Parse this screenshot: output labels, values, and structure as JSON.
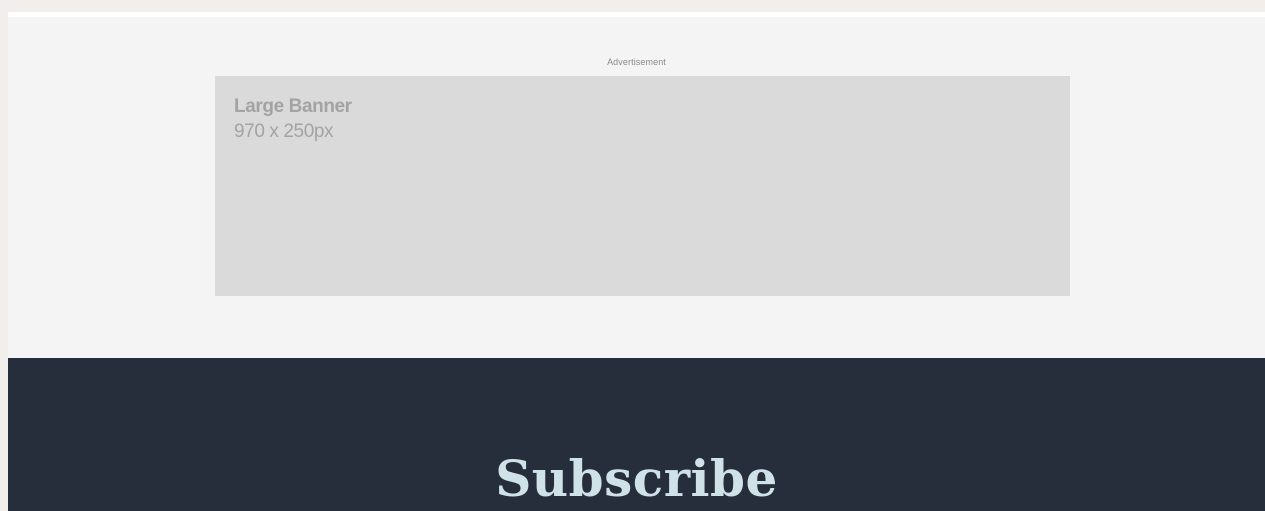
{
  "advertisement": {
    "label": "Advertisement",
    "banner_title": "Large Banner",
    "banner_size": "970 x 250px"
  },
  "subscribe": {
    "title": "Subscribe"
  },
  "colors": {
    "page_background": "#f1eeeb",
    "ad_section_background": "#f4f4f4",
    "ad_banner_background": "#dadada",
    "ad_text": "#a3a3a3",
    "subscribe_background": "#272e3b",
    "subscribe_text": "#cfe2e8"
  }
}
